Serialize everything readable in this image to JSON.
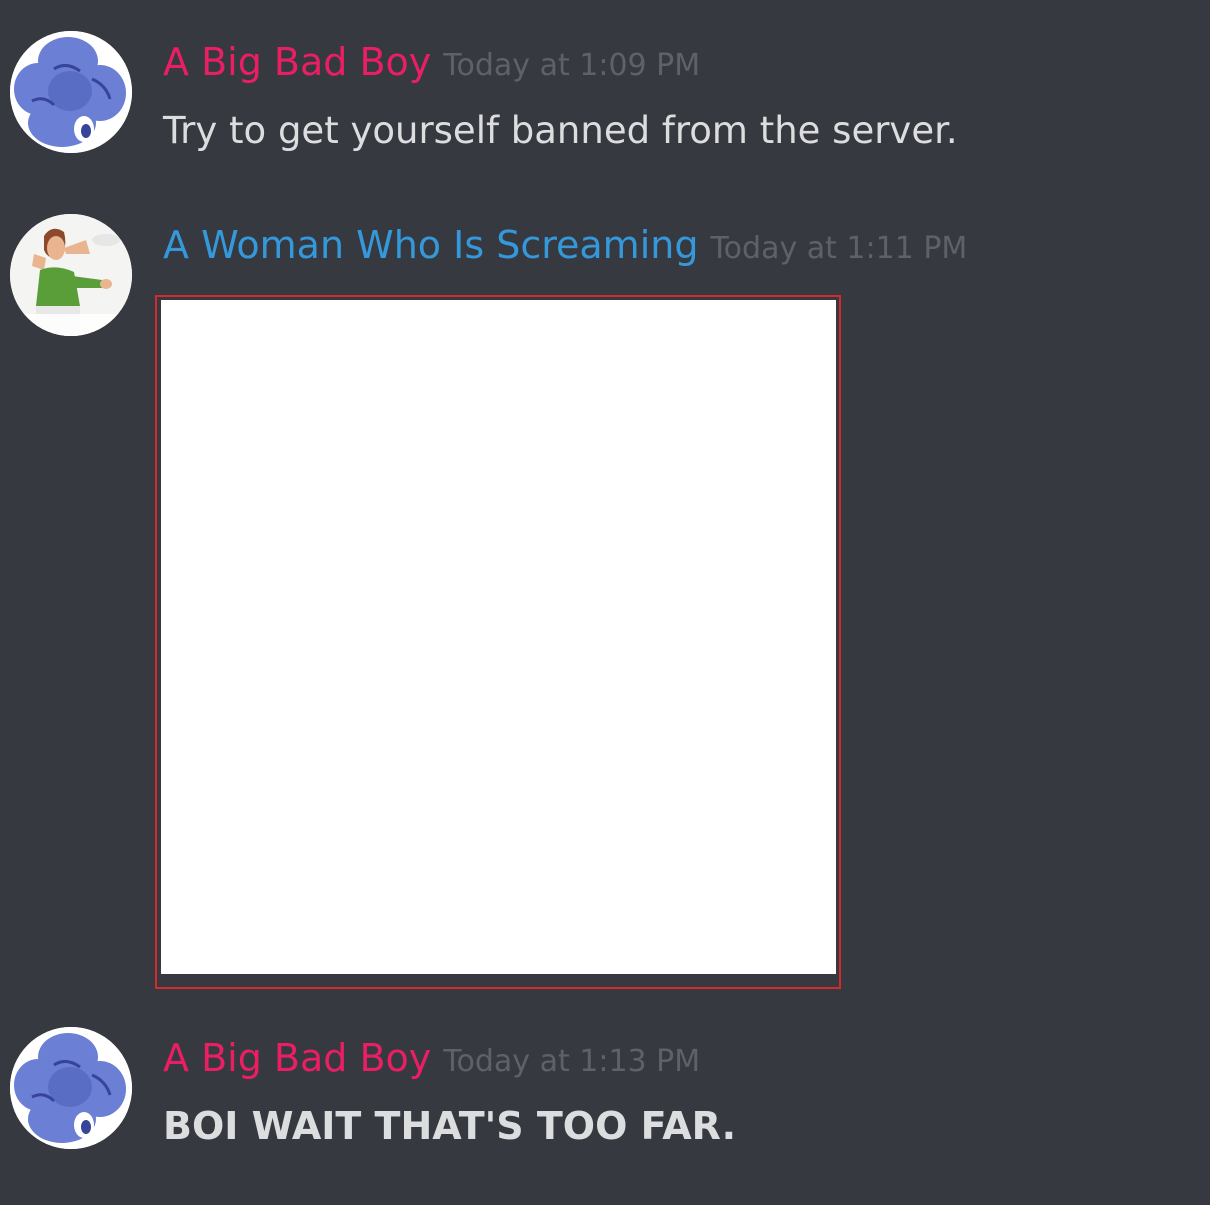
{
  "messages": [
    {
      "username": "A Big Bad Boy",
      "username_color": "#e91e63",
      "timestamp": "Today at 1:09 PM",
      "content": "Try to get yourself banned from the server.",
      "avatar_icon": "flower-bird-avatar"
    },
    {
      "username": "A Woman Who Is Screaming",
      "username_color": "#3498db",
      "timestamp": "Today at 1:11 PM",
      "attachment": "image",
      "avatar_icon": "screaming-woman-avatar"
    },
    {
      "username": "A Big Bad Boy",
      "username_color": "#e91e63",
      "timestamp": "Today at 1:13 PM",
      "content": "BOI WAIT THAT'S TOO FAR.",
      "avatar_icon": "flower-bird-avatar"
    }
  ],
  "colors": {
    "background": "#36393f",
    "message_text": "#dcddde",
    "timestamp": "#5e6167",
    "attachment_border": "#d12b2b"
  }
}
